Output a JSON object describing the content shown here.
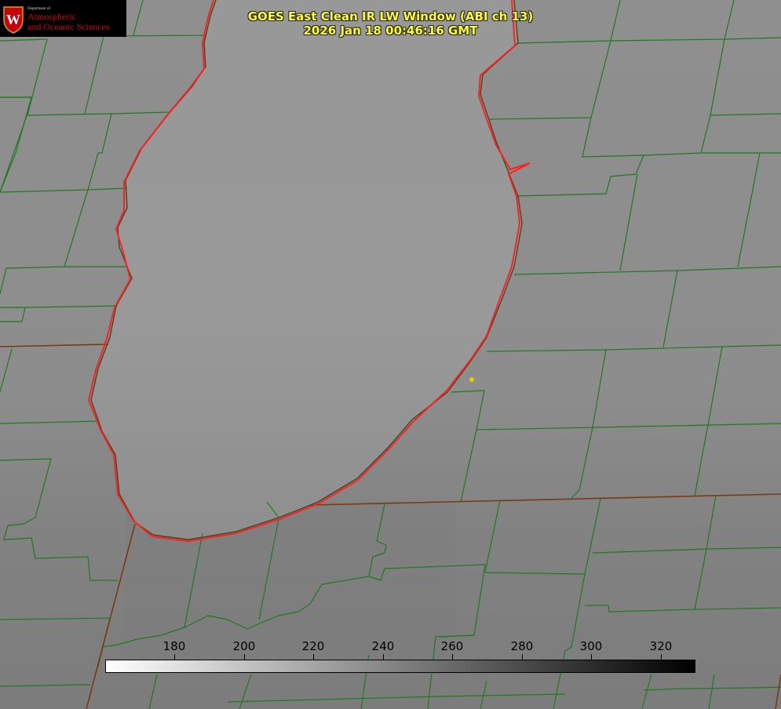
{
  "logo": {
    "seal_letter": "W",
    "dept_line": "Department of",
    "line1": "Atmospheric",
    "line2": "and Oceanic Sciences"
  },
  "title": {
    "line1": "GOES East Clean IR LW Window (ABI ch 13)",
    "line2": "2026 Jan 18 00:46:16 GMT"
  },
  "colorbar": {
    "min": 160,
    "max": 330,
    "ticks": [
      180,
      200,
      220,
      240,
      260,
      280,
      300,
      320
    ],
    "gradient_start": "#ffffff",
    "gradient_end": "#000000"
  },
  "colors": {
    "county_border": "#1f7a1f",
    "state_border": "#7a3a10",
    "coastline": "#ff2020",
    "marker": "#e8d000",
    "title_text": "#ffff33"
  }
}
